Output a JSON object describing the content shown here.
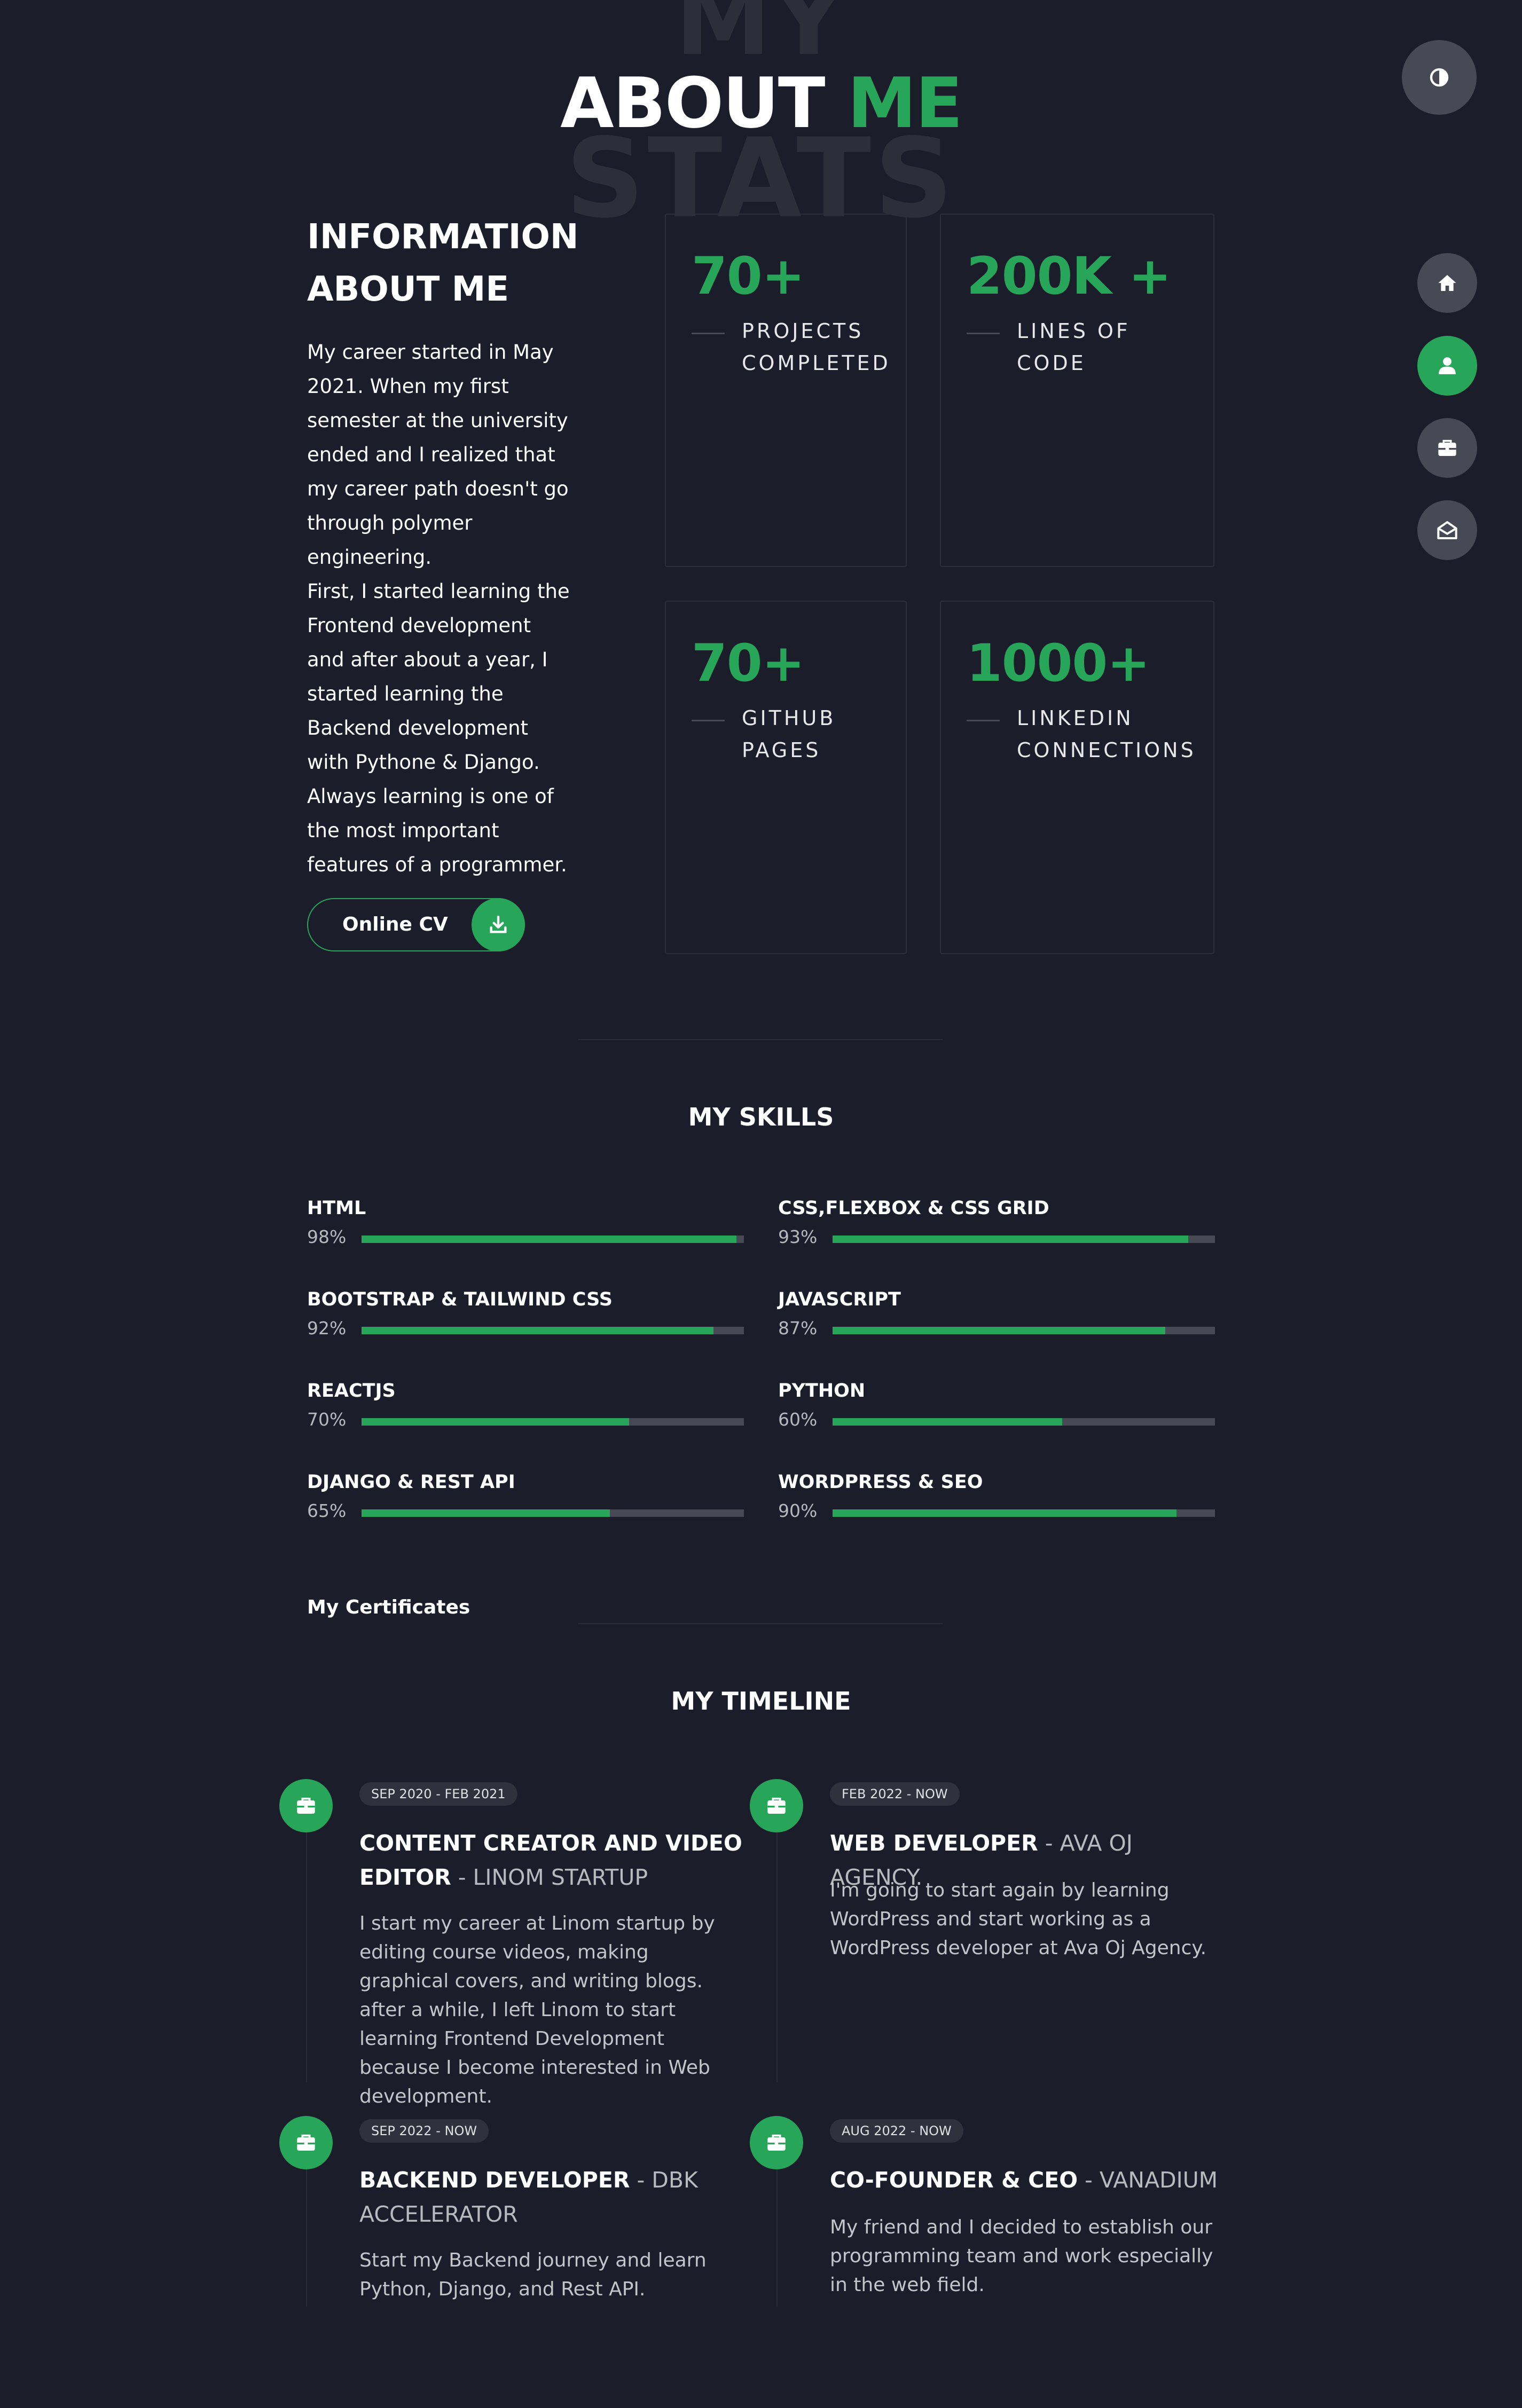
{
  "header": {
    "bg_word_top": "MY",
    "bg_word_bottom": "STATS",
    "title_main": "ABOUT",
    "title_accent": "ME"
  },
  "controls": {
    "theme_icon": "contrast-icon",
    "nav": [
      {
        "icon": "home-icon",
        "active": false
      },
      {
        "icon": "user-icon",
        "active": true
      },
      {
        "icon": "briefcase-icon",
        "active": false
      },
      {
        "icon": "envelope-open-icon",
        "active": false
      }
    ]
  },
  "info": {
    "title_line1": "INFORMATION",
    "title_line2": "ABOUT ME",
    "paragraph1": "My career started in May 2021. When my first semester at the university ended and I realized that my career path doesn't go through polymer engineering.",
    "paragraph2": "First, I started learning the Frontend development and after about a year, I started learning the Backend development with Pythone & Django.",
    "paragraph3": "Always learning is one of the most important features of a programmer.",
    "cv_label": "Online CV",
    "cv_icon": "download-icon"
  },
  "stats": [
    {
      "value": "70+",
      "label_line1": "PROJECTS",
      "label_line2": "COMPLETED"
    },
    {
      "value": "200K +",
      "label_line1": "LINES OF",
      "label_line2": "CODE"
    },
    {
      "value": "70+",
      "label_line1": "GITHUB",
      "label_line2": "PAGES"
    },
    {
      "value": "1000+",
      "label_line1": "LINKEDIN",
      "label_line2": "CONNECTIONS"
    }
  ],
  "skills": {
    "title": "MY SKILLS",
    "items": [
      {
        "name": "HTML",
        "percent_text": "98%",
        "percent": 98
      },
      {
        "name": "CSS,FLEXBOX & CSS GRID",
        "percent_text": "93%",
        "percent": 93
      },
      {
        "name": "BOOTSTRAP & TAILWIND CSS",
        "percent_text": "92%",
        "percent": 92
      },
      {
        "name": "JAVASCRIPT",
        "percent_text": "87%",
        "percent": 87
      },
      {
        "name": "REACTJS",
        "percent_text": "70%",
        "percent": 70
      },
      {
        "name": "PYTHON",
        "percent_text": "60%",
        "percent": 60
      },
      {
        "name": "DJANGO & REST API",
        "percent_text": "65%",
        "percent": 65
      },
      {
        "name": "WORDPRESS & SEO",
        "percent_text": "90%",
        "percent": 90
      }
    ]
  },
  "certificates": {
    "title": "My Certificates"
  },
  "timeline": {
    "title": "MY TIMELINE",
    "items": [
      {
        "date": "SEP 2020 - FEB 2021",
        "role_line1": "CONTENT CREATOR AND VIDEO",
        "role_line2": "EDITOR",
        "org": " - LINOM STARTUP",
        "desc": "I start my career at Linom startup by editing course videos, making graphical covers, and writing blogs. after a while, I left Linom to start learning Frontend Development because I become interested in Web development.",
        "icon": "briefcase-icon"
      },
      {
        "date": "FEB 2022 - NOW",
        "role_line1": "WEB DEVELOPER",
        "org": " - AVA OJ AGENCY.",
        "desc": "I'm going to start again by learning WordPress and start working as a WordPress developer at Ava Oj Agency.",
        "icon": "briefcase-icon"
      },
      {
        "date": "SEP 2022 - NOW",
        "role_line1": "BACKEND DEVELOPER",
        "org": " - DBK ACCELERATOR",
        "desc": "Start my Backend journey and learn Python, Django, and Rest API.",
        "icon": "briefcase-icon"
      },
      {
        "date": "AUG 2022 - NOW",
        "role_line1": "CO-FOUNDER & CEO",
        "org": " - VANADIUM",
        "desc": "My friend and I decided to establish our programming team and work especially in the web field.",
        "icon": "briefcase-icon"
      }
    ]
  },
  "colors": {
    "background": "#1b1d2a",
    "accent": "#27a65a",
    "button_gray": "#474a55",
    "track_gray": "#474a55"
  }
}
